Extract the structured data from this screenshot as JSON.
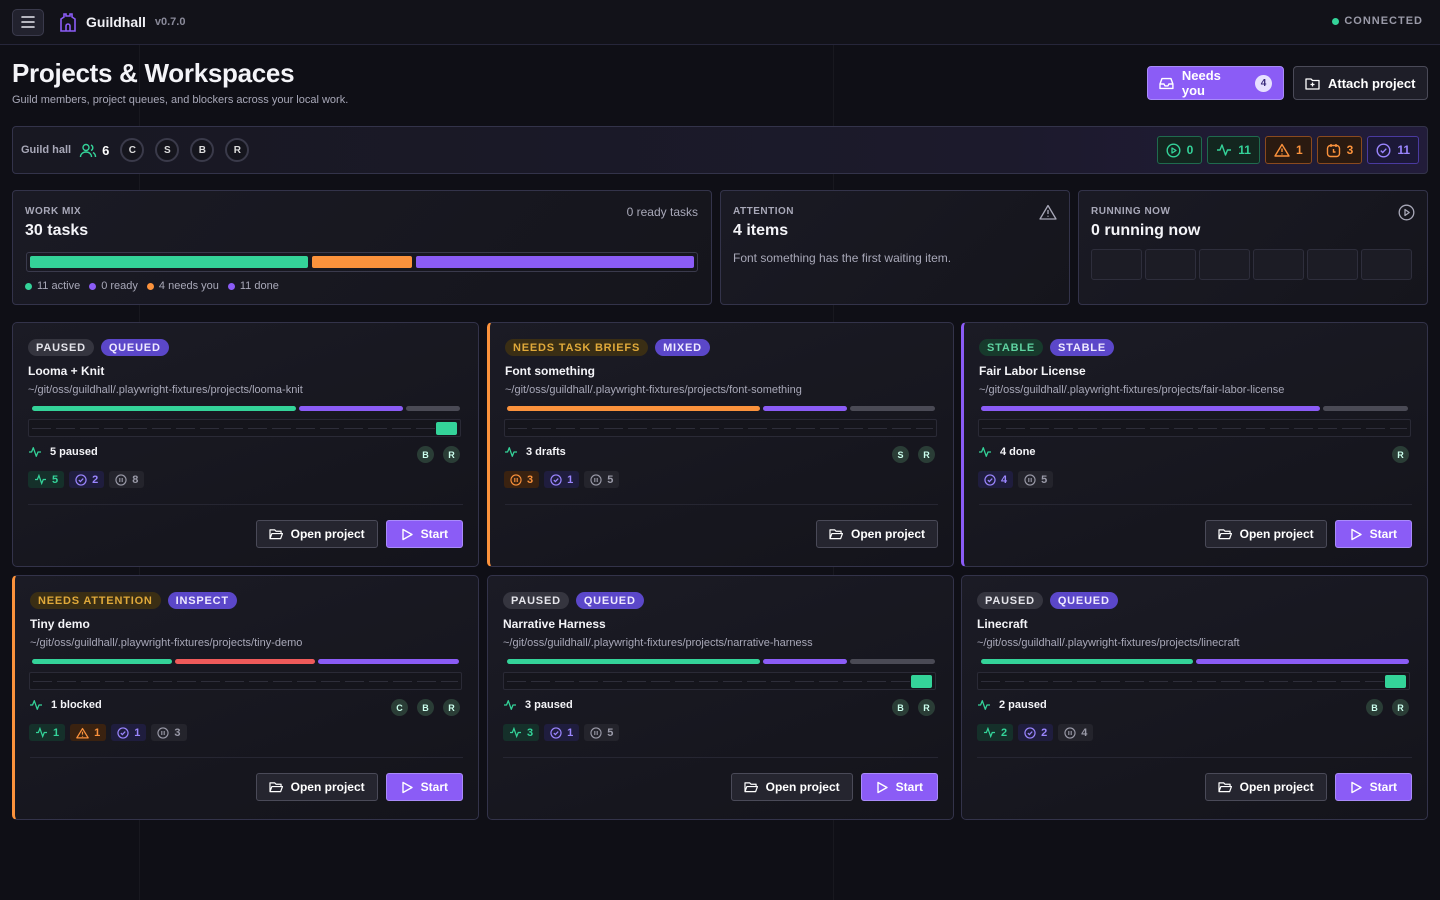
{
  "app": {
    "name": "Guildhall",
    "version": "v0.7.0",
    "connection": "CONNECTED"
  },
  "header": {
    "title": "Projects & Workspaces",
    "subtitle": "Guild members, project queues, and blockers across your local work.",
    "needs_you_label": "Needs you",
    "needs_you_count": "4",
    "attach_label": "Attach project"
  },
  "guild": {
    "label": "Guild hall",
    "member_count": "6",
    "members": [
      "C",
      "S",
      "B",
      "R"
    ],
    "stats": {
      "running": "0",
      "active": "11",
      "attention": "1",
      "paused": "3",
      "done": "11"
    }
  },
  "work_mix": {
    "caption": "WORK MIX",
    "total": "30 tasks",
    "ready_note": "0 ready tasks",
    "bar": {
      "active": 11,
      "needs_you": 4,
      "done": 11
    },
    "legend": {
      "active": "11 active",
      "ready": "0 ready",
      "needs_you": "4 needs you",
      "done": "11 done"
    },
    "colors": {
      "active": "#34d399",
      "ready": "#8b5cf6",
      "needs_you": "#fb923c",
      "done": "#8b5cf6"
    }
  },
  "attention": {
    "caption": "ATTENTION",
    "count": "4 items",
    "note": "Font something has the first waiting item."
  },
  "running": {
    "caption": "RUNNING NOW",
    "count": "0 running now"
  },
  "buttons": {
    "open": "Open project",
    "start": "Start"
  },
  "projects": [
    {
      "tags": [
        "PAUSED",
        "QUEUED"
      ],
      "name": "Looma + Knit",
      "path": "~/git/oss/guildhall/.playwright-fixtures/projects/looma-knit",
      "status": "5 paused",
      "owners": [
        "B",
        "R"
      ],
      "chip_active": "5",
      "chip_done": "2",
      "chip_paused": "8"
    },
    {
      "tags": [
        "NEEDS TASK BRIEFS",
        "MIXED"
      ],
      "name": "Font something",
      "path": "~/git/oss/guildhall/.playwright-fixtures/projects/font-something",
      "status": "3 drafts",
      "owners": [
        "S",
        "R"
      ],
      "chip_drafts": "3",
      "chip_done": "1",
      "chip_paused": "5"
    },
    {
      "tags": [
        "STABLE",
        "STABLE"
      ],
      "name": "Fair Labor License",
      "path": "~/git/oss/guildhall/.playwright-fixtures/projects/fair-labor-license",
      "status": "4 done",
      "owners": [
        "R"
      ],
      "chip_done": "4",
      "chip_paused": "5"
    },
    {
      "tags": [
        "NEEDS ATTENTION",
        "INSPECT"
      ],
      "name": "Tiny demo",
      "path": "~/git/oss/guildhall/.playwright-fixtures/projects/tiny-demo",
      "status": "1 blocked",
      "owners": [
        "C",
        "B",
        "R"
      ],
      "chip_active": "1",
      "chip_blocked": "1",
      "chip_done": "1",
      "chip_paused": "3"
    },
    {
      "tags": [
        "PAUSED",
        "QUEUED"
      ],
      "name": "Narrative Harness",
      "path": "~/git/oss/guildhall/.playwright-fixtures/projects/narrative-harness",
      "status": "3 paused",
      "owners": [
        "B",
        "R"
      ],
      "chip_active": "3",
      "chip_done": "1",
      "chip_paused": "5"
    },
    {
      "tags": [
        "PAUSED",
        "QUEUED"
      ],
      "name": "Linecraft",
      "path": "~/git/oss/guildhall/.playwright-fixtures/projects/linecraft",
      "status": "2 paused",
      "owners": [
        "B",
        "R"
      ],
      "chip_active": "2",
      "chip_done": "2",
      "chip_paused": "4"
    }
  ]
}
